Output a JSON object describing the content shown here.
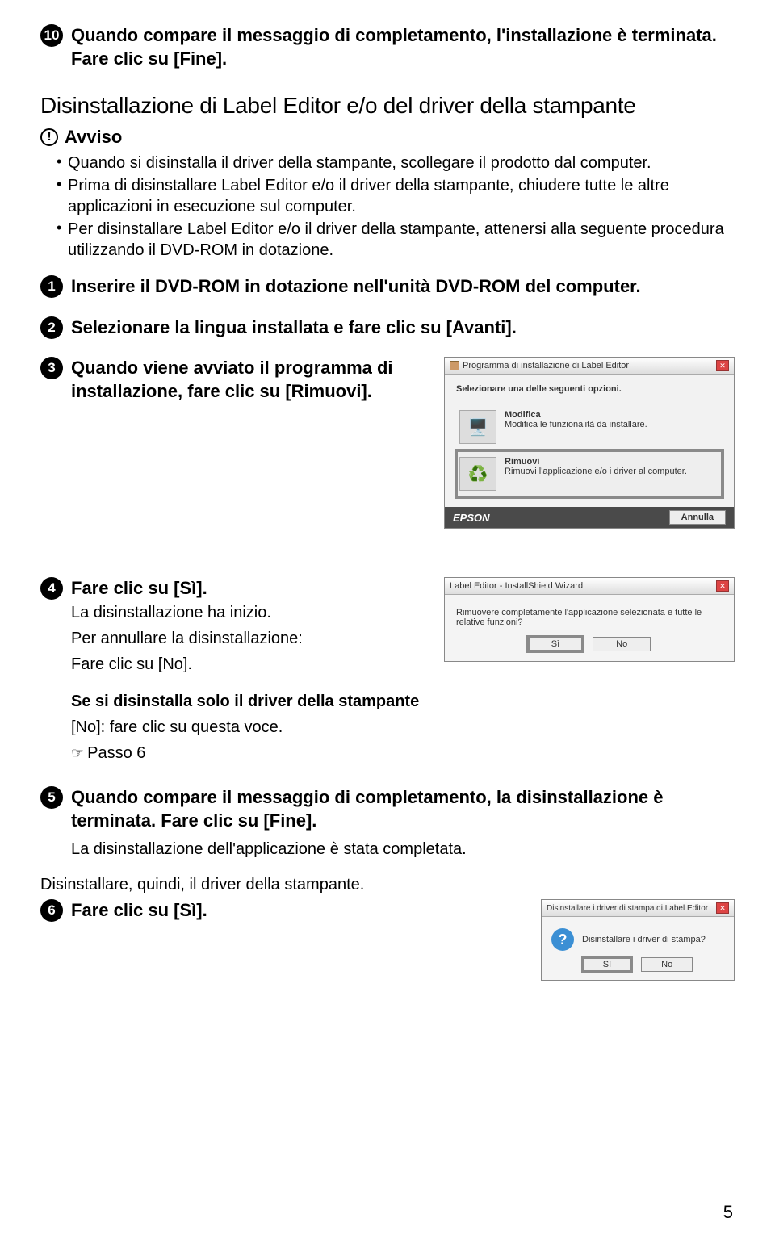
{
  "step10": {
    "num": "10",
    "text": "Quando compare il messaggio di completamento, l'installazione è terminata. Fare clic su [Fine]."
  },
  "section_title": "Disinstallazione di Label Editor e/o del driver della stampante",
  "avviso": {
    "icon": "!",
    "label": "Avviso",
    "b1": "Quando si disinstalla il driver della stampante, scollegare il prodotto dal computer.",
    "b2": "Prima di disinstallare Label Editor e/o il driver della stampante, chiudere tutte le altre applicazioni in esecuzione sul computer.",
    "b3": "Per disinstallare Label Editor e/o il driver della stampante, attenersi alla seguente procedura utilizzando il DVD-ROM in dotazione."
  },
  "step1": {
    "num": "1",
    "text": "Inserire il DVD-ROM in dotazione nell'unità DVD-ROM del computer."
  },
  "step2": {
    "num": "2",
    "text": "Selezionare la lingua installata e fare clic su [Avanti]."
  },
  "step3": {
    "num": "3",
    "text": "Quando viene avviato il programma di installazione, fare clic su [Rimuovi]."
  },
  "install_dialog": {
    "title": "Programma di installazione di Label Editor",
    "heading": "Selezionare una delle seguenti opzioni.",
    "opt1_title": "Modifica",
    "opt1_desc": "Modifica le funzionalità da installare.",
    "opt2_title": "Rimuovi",
    "opt2_desc": "Rimuovi l'applicazione e/o i driver al computer.",
    "brand": "EPSON",
    "cancel": "Annulla"
  },
  "step4": {
    "num": "4",
    "bold": "Fare clic su [Sì].",
    "l1": "La disinstallazione ha inizio.",
    "l2": "Per annullare la disinstallazione:",
    "l3": "Fare clic su [No].",
    "sub_bold": "Se si disinstalla solo il driver della stampante",
    "sub_l1": "[No]: fare clic su questa voce.",
    "sub_l2": "Passo 6"
  },
  "confirm_dialog": {
    "title": "Label Editor - InstallShield Wizard",
    "msg": "Rimuovere completamente l'applicazione selezionata e tutte le relative funzioni?",
    "yes": "Sì",
    "no": "No"
  },
  "step5": {
    "num": "5",
    "bold1": "Quando compare il messaggio di completamento, la disinstallazione è terminata. Fare clic su [Fine].",
    "l1": "La disinstallazione dell'applicazione è stata completata."
  },
  "after5": "Disinstallare, quindi, il driver della stampante.",
  "step6": {
    "num": "6",
    "bold": "Fare clic su [Sì]."
  },
  "uninstall_dialog": {
    "title": "Disinstallare i driver di stampa di Label Editor",
    "msg": "Disinstallare i driver di stampa?",
    "yes": "Sì",
    "no": "No"
  },
  "page": "5"
}
